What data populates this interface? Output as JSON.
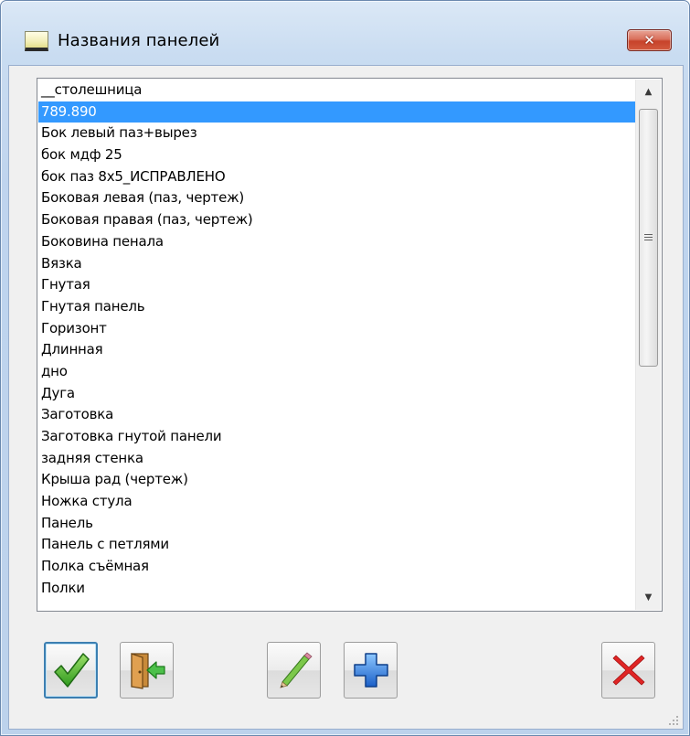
{
  "window": {
    "title": "Названия панелей",
    "close_symbol": "✕"
  },
  "list": {
    "selected_index": 1,
    "items": [
      "__столешница",
      "789.890",
      "Бок левый паз+вырез",
      "бок мдф 25",
      "бок паз 8х5_ИСПРАВЛЕНО",
      "Боковая левая  (паз, чертеж)",
      "Боковая правая  (паз, чертеж)",
      "Боковина пенала",
      "Вязка",
      "Гнутая",
      "Гнутая панель",
      "Горизонт",
      "Длинная",
      "дно",
      "Дуга",
      "Заготовка",
      "Заготовка гнутой панели",
      "задняя стенка",
      "Крыша рад (чертеж)",
      "Ножка стула",
      "Панель",
      "Панель с петлями",
      "Полка съёмная",
      "Полки"
    ]
  },
  "scrollbar": {
    "up_icon": "▲",
    "down_icon": "▼"
  },
  "toolbar": {
    "buttons": [
      {
        "name": "ok",
        "icon": "green-checkmark-icon"
      },
      {
        "name": "exit",
        "icon": "door-exit-arrow-icon"
      },
      {
        "name": "edit",
        "icon": "pencil-icon"
      },
      {
        "name": "add",
        "icon": "blue-plus-icon"
      },
      {
        "name": "delete",
        "icon": "red-x-icon"
      }
    ]
  },
  "colors": {
    "selection": "#3399ff",
    "close_button": "#c7432a",
    "check_green": "#3aa52a",
    "plus_blue": "#1f6fd0",
    "delete_red": "#e02020"
  }
}
